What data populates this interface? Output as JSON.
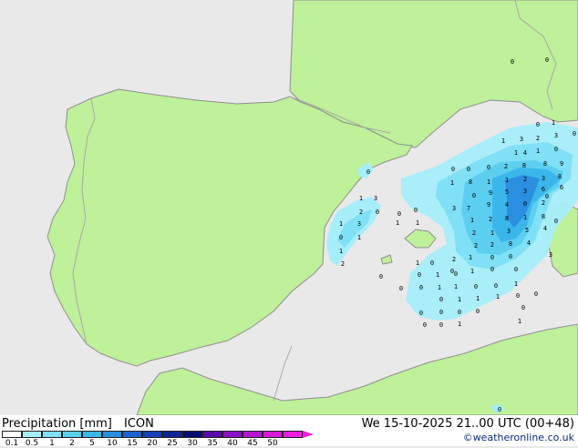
{
  "map": {
    "colors": {
      "sea": "#e9e9e9",
      "land": "#bff09a",
      "coast": "#8f8f8f",
      "border": "#a8a8a8"
    },
    "precip_values": [
      {
        "v": "0"
      },
      {
        "v": "0"
      },
      {
        "v": "0"
      },
      {
        "v": "1"
      },
      {
        "v": "1"
      },
      {
        "v": "3"
      },
      {
        "v": "2"
      },
      {
        "v": "3"
      },
      {
        "v": "0"
      },
      {
        "v": "1"
      },
      {
        "v": "4"
      },
      {
        "v": "1"
      },
      {
        "v": "0"
      },
      {
        "v": "0"
      },
      {
        "v": "0"
      },
      {
        "v": "0"
      },
      {
        "v": "2"
      },
      {
        "v": "8"
      },
      {
        "v": "8"
      },
      {
        "v": "9"
      },
      {
        "v": "1"
      },
      {
        "v": "8"
      },
      {
        "v": "1"
      },
      {
        "v": "1"
      },
      {
        "v": "2"
      },
      {
        "v": "3"
      },
      {
        "v": "8"
      },
      {
        "v": "9"
      },
      {
        "v": "5"
      },
      {
        "v": "3"
      },
      {
        "v": "6"
      },
      {
        "v": "6"
      },
      {
        "v": "9"
      },
      {
        "v": "4"
      },
      {
        "v": "0"
      },
      {
        "v": "2"
      },
      {
        "v": "3"
      },
      {
        "v": "7"
      },
      {
        "v": "8"
      },
      {
        "v": "1"
      },
      {
        "v": "1"
      },
      {
        "v": "2"
      },
      {
        "v": "8"
      },
      {
        "v": "2"
      },
      {
        "v": "1"
      },
      {
        "v": "3"
      },
      {
        "v": "5"
      },
      {
        "v": "4"
      },
      {
        "v": "2"
      },
      {
        "v": "2"
      },
      {
        "v": "8"
      },
      {
        "v": "4"
      },
      {
        "v": "3"
      },
      {
        "v": "1"
      },
      {
        "v": "3"
      },
      {
        "v": "2"
      },
      {
        "v": "0"
      },
      {
        "v": "1"
      },
      {
        "v": "3"
      },
      {
        "v": "1"
      },
      {
        "v": "1"
      },
      {
        "v": "0"
      },
      {
        "v": "1"
      },
      {
        "v": "1"
      },
      {
        "v": "2"
      },
      {
        "v": "2"
      },
      {
        "v": "1"
      },
      {
        "v": "0"
      },
      {
        "v": "0"
      },
      {
        "v": "1"
      },
      {
        "v": "0"
      },
      {
        "v": "0"
      },
      {
        "v": "1"
      },
      {
        "v": "0"
      },
      {
        "v": "0"
      },
      {
        "v": "0"
      },
      {
        "v": "0"
      },
      {
        "v": "1"
      },
      {
        "v": "0"
      },
      {
        "v": "0"
      },
      {
        "v": "0"
      },
      {
        "v": "1"
      },
      {
        "v": "0"
      },
      {
        "v": "0"
      },
      {
        "v": "1"
      },
      {
        "v": "1"
      },
      {
        "v": "0"
      },
      {
        "v": "1"
      },
      {
        "v": "1"
      },
      {
        "v": "1"
      },
      {
        "v": "0"
      },
      {
        "v": "0"
      },
      {
        "v": "0"
      },
      {
        "v": "0"
      },
      {
        "v": "0"
      },
      {
        "v": "0"
      },
      {
        "v": "0"
      },
      {
        "v": "0"
      },
      {
        "v": "1"
      },
      {
        "v": "1"
      },
      {
        "v": "0"
      },
      {
        "v": "0"
      },
      {
        "v": "0"
      },
      {
        "v": "0"
      },
      {
        "v": "0"
      },
      {
        "v": "0"
      },
      {
        "v": "0"
      },
      {
        "v": "0"
      },
      {
        "v": "0"
      },
      {
        "v": "0"
      }
    ]
  },
  "legend": {
    "title": "Precipitation [mm]",
    "model": "ICON",
    "datetime": "We 15-10-2025 21..00 UTC (00+48)",
    "credit": "©weatheronline.co.uk",
    "scale_colors": [
      "#ffffff",
      "#a6eefa",
      "#7fe0f6",
      "#5ccff0",
      "#3bb6ea",
      "#2a8fe0",
      "#1f60cf",
      "#1740b4",
      "#0e2493",
      "#060e6e",
      "#5a0aa8",
      "#8a12c4",
      "#b616d2",
      "#d81ad6",
      "#f01fe0"
    ],
    "scale_ticks": [
      "0.1",
      "0.5",
      "1",
      "2",
      "5",
      "10",
      "15",
      "20",
      "25",
      "30",
      "35",
      "40",
      "45",
      "50"
    ]
  }
}
